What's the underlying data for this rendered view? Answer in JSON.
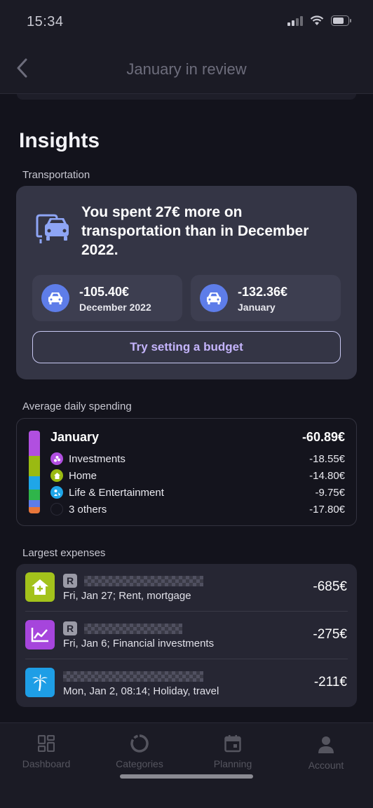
{
  "status_bar": {
    "time": "15:34"
  },
  "header": {
    "title": "January in review"
  },
  "insights": {
    "title": "Insights",
    "section_label": "Transportation",
    "message": "You spent 27€ more on transportation than in December 2022.",
    "comparisons": [
      {
        "amount": "-105.40€",
        "label": "December 2022"
      },
      {
        "amount": "-132.36€",
        "label": "January"
      }
    ],
    "budget_button": "Try setting a budget"
  },
  "average_daily": {
    "section_label": "Average daily spending",
    "month": "January",
    "total": "-60.89€",
    "categories": [
      {
        "name": "Investments",
        "value": "-18.55€",
        "color": "#b14fe0"
      },
      {
        "name": "Home",
        "value": "-14.80€",
        "color": "#9aba12"
      },
      {
        "name": "Life & Entertainment",
        "value": "-9.75€",
        "color": "#1fa6e8"
      },
      {
        "name": "3 others",
        "value": "-17.80€",
        "color": "#14141d"
      }
    ],
    "bar_colors": [
      "#b14fe0",
      "#9aba12",
      "#1fa6e8",
      "#2fb54a",
      "#5e7de9",
      "#e8763a"
    ]
  },
  "largest_expenses": {
    "section_label": "Largest expenses",
    "items": [
      {
        "badge": "R",
        "description": "Fri, Jan 27; Rent, mortgage",
        "amount": "-685€",
        "icon": "home-icon",
        "color": "#a3c21b"
      },
      {
        "badge": "R",
        "description": "Fri, Jan 6; Financial investments",
        "amount": "-275€",
        "icon": "chart-icon",
        "color": "#a645dc"
      },
      {
        "badge": "",
        "description": "Mon, Jan 2, 08:14; Holiday, travel",
        "amount": "-211€",
        "icon": "palm-tree-icon",
        "color": "#1e9ee6"
      }
    ]
  },
  "tab_bar": {
    "tabs": [
      {
        "label": "Dashboard",
        "icon": "dashboard-icon"
      },
      {
        "label": "Categories",
        "icon": "categories-icon"
      },
      {
        "label": "Planning",
        "icon": "calendar-icon"
      },
      {
        "label": "Account",
        "icon": "person-icon"
      }
    ]
  }
}
